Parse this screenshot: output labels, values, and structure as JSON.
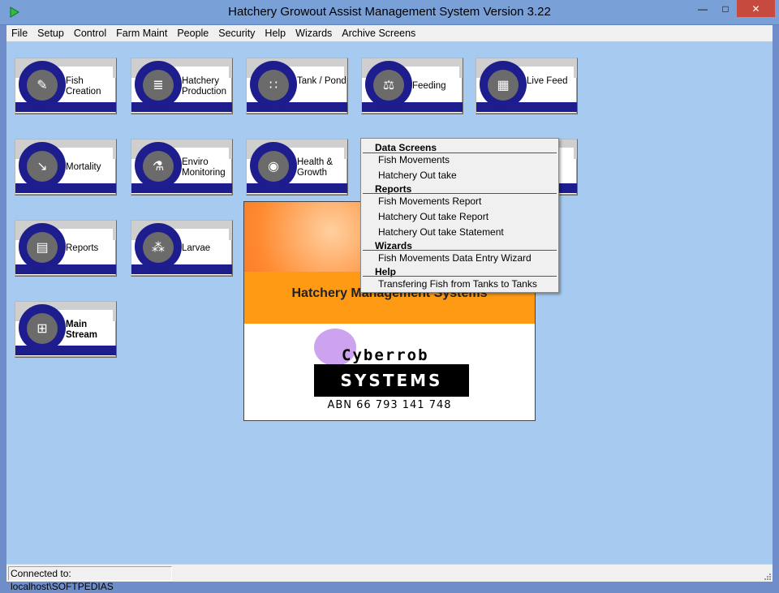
{
  "window": {
    "title": "Hatchery Growout Assist Management System Version 3.22",
    "min_glyph": "—",
    "max_glyph": "□",
    "close_glyph": "✕"
  },
  "menu": [
    "File",
    "Setup",
    "Control",
    "Farm Maint",
    "People",
    "Security",
    "Help",
    "Wizards",
    "Archive Screens"
  ],
  "tiles": [
    {
      "label": "Fish Creation",
      "icon": "fish-egg-icon",
      "glyph": "✎"
    },
    {
      "label": "Hatchery Production",
      "icon": "production-icon",
      "glyph": "≣"
    },
    {
      "label": "Tank / Pond",
      "icon": "tanks-icon",
      "glyph": "∷"
    },
    {
      "label": "Feeding",
      "icon": "scales-icon",
      "glyph": "⚖"
    },
    {
      "label": "Live Feed",
      "icon": "live-feed-icon",
      "glyph": "▦"
    },
    {
      "label": "Mortality",
      "icon": "mortality-icon",
      "glyph": "↘"
    },
    {
      "label": "Enviro Monitoring",
      "icon": "microscope-icon",
      "glyph": "⚗"
    },
    {
      "label": "Health & Growth",
      "icon": "fish-icon",
      "glyph": "◉"
    },
    {
      "label": "Reports",
      "icon": "reports-icon",
      "glyph": "▤"
    },
    {
      "label": "Larvae",
      "icon": "larvae-icon",
      "glyph": "⁂"
    },
    {
      "label": "Main Stream",
      "icon": "org-chart-icon",
      "glyph": "⊞"
    }
  ],
  "popup": {
    "sections": [
      {
        "title": "Data Screens",
        "items": [
          "Fish Movements",
          "Hatchery Out take"
        ]
      },
      {
        "title": "Reports",
        "items": [
          "Fish Movements Report",
          "Hatchery Out take Report",
          "Hatchery Out take Statement"
        ]
      },
      {
        "title": "Wizards",
        "items": [
          "Fish Movements Data Entry Wizard"
        ]
      },
      {
        "title": "Help",
        "items": [
          "Transfering Fish from Tanks to Tanks"
        ]
      }
    ]
  },
  "splash": {
    "title": "Hatchery Management Systems",
    "company": "Cyberrob",
    "systems": "SYSTEMS",
    "abn": "ABN 66 793 141 748"
  },
  "status": {
    "connection": "Connected to: localhost\\SOFTPEDIAS"
  }
}
